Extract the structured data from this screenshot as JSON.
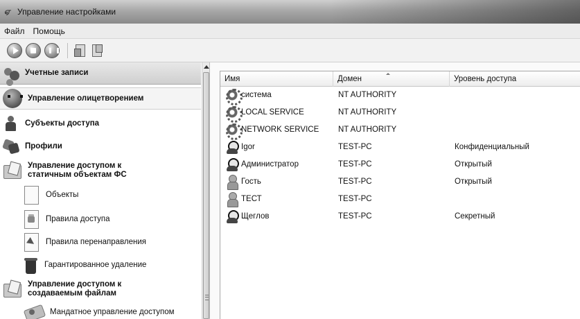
{
  "window": {
    "app_icon": "ஏ",
    "title": "Управление настройками"
  },
  "menu": {
    "items": [
      "Файл",
      "Помощь"
    ]
  },
  "toolbar": {
    "buttons": [
      "play-icon",
      "stop-icon",
      "pause-icon",
      "document-icon",
      "documents-icon"
    ]
  },
  "sidebar": {
    "items": [
      {
        "label": "Учетные записи",
        "icon": "users-icon",
        "kind": "header",
        "selected": true
      },
      {
        "label": "Управление олицетворением",
        "icon": "mask-icon",
        "kind": "header"
      },
      {
        "label": "Субъекты доступа",
        "icon": "person-icon",
        "kind": "header"
      },
      {
        "label": "Профили",
        "icon": "profiles-icon",
        "kind": "header"
      },
      {
        "label": "Управление доступом к статичным объектам ФС",
        "icon": "folder-icon",
        "kind": "header"
      },
      {
        "label": "Объекты",
        "icon": "page-icon",
        "kind": "sub"
      },
      {
        "label": "Правила доступа",
        "icon": "lock-page-icon",
        "kind": "sub"
      },
      {
        "label": "Правила перенаправления",
        "icon": "redirect-page-icon",
        "kind": "sub"
      },
      {
        "label": "Гарантированное удаление",
        "icon": "trash-icon",
        "kind": "sub"
      },
      {
        "label": "Управление доступом к создаваемым файлам",
        "icon": "folder-icon",
        "kind": "header"
      },
      {
        "label": "Мандатное управление доступом",
        "icon": "mandate-icon",
        "kind": "sub"
      }
    ]
  },
  "table": {
    "columns": [
      "Имя",
      "Домен",
      "Уровень доступа"
    ],
    "rows": [
      {
        "name": "система",
        "domain": "NT AUTHORITY",
        "access": "",
        "icon": "gear-icon"
      },
      {
        "name": "LOCAL SERVICE",
        "domain": "NT AUTHORITY",
        "access": "",
        "icon": "gear-icon"
      },
      {
        "name": "NETWORK SERVICE",
        "domain": "NT AUTHORITY",
        "access": "",
        "icon": "gear-icon"
      },
      {
        "name": "Igor",
        "domain": "TEST-PC",
        "access": "Конфиденциальный",
        "icon": "user-icon"
      },
      {
        "name": "Администратор",
        "domain": "TEST-PC",
        "access": "Открытый",
        "icon": "user-icon"
      },
      {
        "name": "Гость",
        "domain": "TEST-PC",
        "access": "Открытый",
        "icon": "guest-icon"
      },
      {
        "name": "ТЕСТ",
        "domain": "TEST-PC",
        "access": "",
        "icon": "guest-icon"
      },
      {
        "name": "Щеглов",
        "domain": "TEST-PC",
        "access": "Секретный",
        "icon": "user-icon"
      }
    ]
  }
}
